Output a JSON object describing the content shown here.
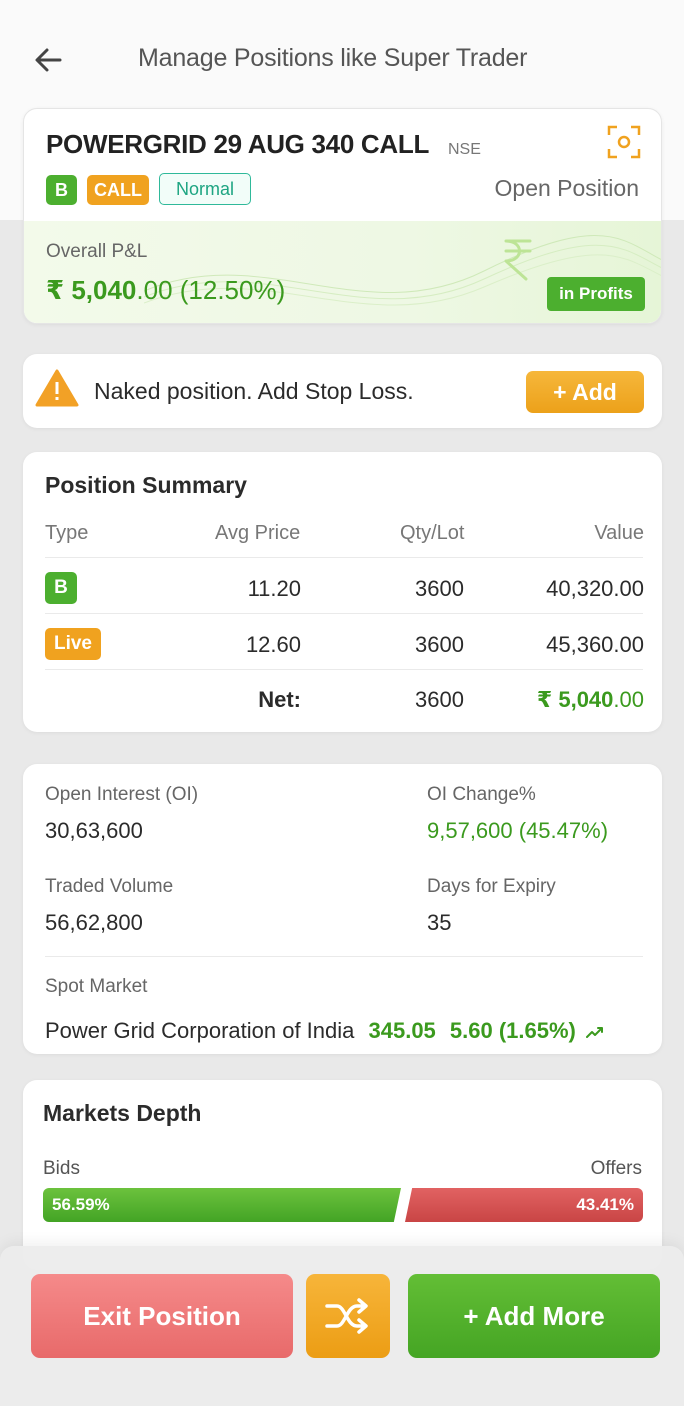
{
  "header": {
    "title": "Manage Positions like Super Trader"
  },
  "instrument": {
    "name": "POWERGRID 29 AUG 340 CALL",
    "exchange": "NSE",
    "side_badge": "B",
    "option_badge": "CALL",
    "type_badge": "Normal",
    "status": "Open Position",
    "pnl_label": "Overall P&L",
    "pnl_main": "₹ 5,040",
    "pnl_decimal": ".00 (12.50%)",
    "profit_badge": "in Profits"
  },
  "alert": {
    "text": "Naked position. Add Stop Loss.",
    "button": "+ Add"
  },
  "summary": {
    "title": "Position Summary",
    "headers": [
      "Type",
      "Avg Price",
      "Qty/Lot",
      "Value"
    ],
    "rows": [
      {
        "badge": "B",
        "badge_color": "#4caf2f",
        "avg": "11.20",
        "qty": "3600",
        "value": "40,320.00"
      },
      {
        "badge": "Live",
        "badge_color": "#f0a21f",
        "avg": "12.60",
        "qty": "3600",
        "value": "45,360.00"
      }
    ],
    "net_label": "Net:",
    "net_qty": "3600",
    "net_value_main": "₹ 5,040",
    "net_value_decimal": ".00"
  },
  "stats": {
    "oi_label": "Open Interest (OI)",
    "oi_value": "30,63,600",
    "oi_change_label": "OI Change%",
    "oi_change_value": "9,57,600 (45.47%)",
    "volume_label": "Traded Volume",
    "volume_value": "56,62,800",
    "expiry_label": "Days for Expiry",
    "expiry_value": "35",
    "spot_label": "Spot Market",
    "spot_name": "Power Grid Corporation of India",
    "spot_price": "345.05",
    "spot_change": "5.60 (1.65%)"
  },
  "depth": {
    "title": "Markets Depth",
    "bids_label": "Bids",
    "offers_label": "Offers",
    "bids_pct": "56.59%",
    "offers_pct": "43.41%",
    "bids_fraction": 0.5659
  },
  "actions": {
    "exit": "Exit Position",
    "add_more": "+ Add More"
  },
  "colors": {
    "green": "#3b9a1e",
    "orange": "#f0a21f",
    "red": "#e86a6a"
  },
  "icons": [
    "back-arrow-icon",
    "scan-icon",
    "rupee-icon",
    "warning-icon",
    "trend-up-icon",
    "shuffle-icon"
  ]
}
